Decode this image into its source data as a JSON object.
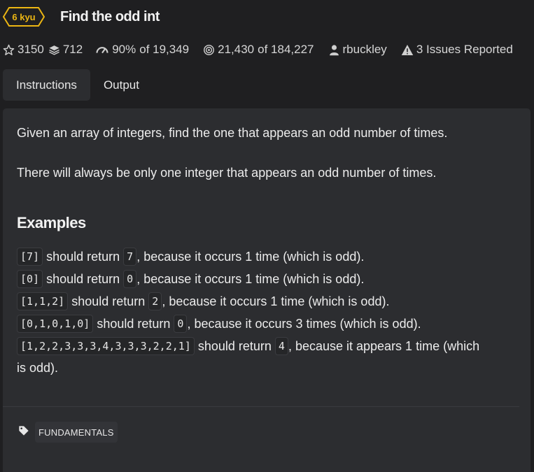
{
  "kata": {
    "rank": "6 kyu",
    "title": "Find the odd int"
  },
  "stats": {
    "stars": "3150",
    "collections": "712",
    "satisfaction": "90%",
    "satisfaction_of": "of 19,349",
    "completed": "21,430",
    "completed_of": "of 184,227",
    "author": "rbuckley",
    "issues": "3 Issues Reported"
  },
  "tabs": [
    {
      "label": "Instructions",
      "active": true
    },
    {
      "label": "Output",
      "active": false
    }
  ],
  "description": {
    "para1": "Given an array of integers, find the one that appears an odd number of times.",
    "para2": "There will always be only one integer that appears an odd number of times.",
    "examples_heading": "Examples",
    "examples": [
      {
        "input": "[7]",
        "middle": " should return ",
        "output": "7",
        "tail": ", because it occurs 1 time (which is odd)."
      },
      {
        "input": "[0]",
        "middle": " should return ",
        "output": "0",
        "tail": ", because it occurs 1 time (which is odd)."
      },
      {
        "input": "[1,1,2]",
        "middle": " should return ",
        "output": "2",
        "tail": ", because it occurs 1 time (which is odd)."
      },
      {
        "input": "[0,1,0,1,0]",
        "middle": " should return ",
        "output": "0",
        "tail": ", because it occurs 3 times (which is odd)."
      },
      {
        "input": "[1,2,2,3,3,3,4,3,3,3,2,2,1]",
        "middle": " should return ",
        "output": "4",
        "tail": ", because it appears 1 time (which",
        "tail2": "is odd)."
      }
    ]
  },
  "tags": [
    "FUNDAMENTALS"
  ],
  "colors": {
    "background": "#1f1f21",
    "panel": "#2c2d30",
    "rank_yellow": "#ecb613"
  }
}
